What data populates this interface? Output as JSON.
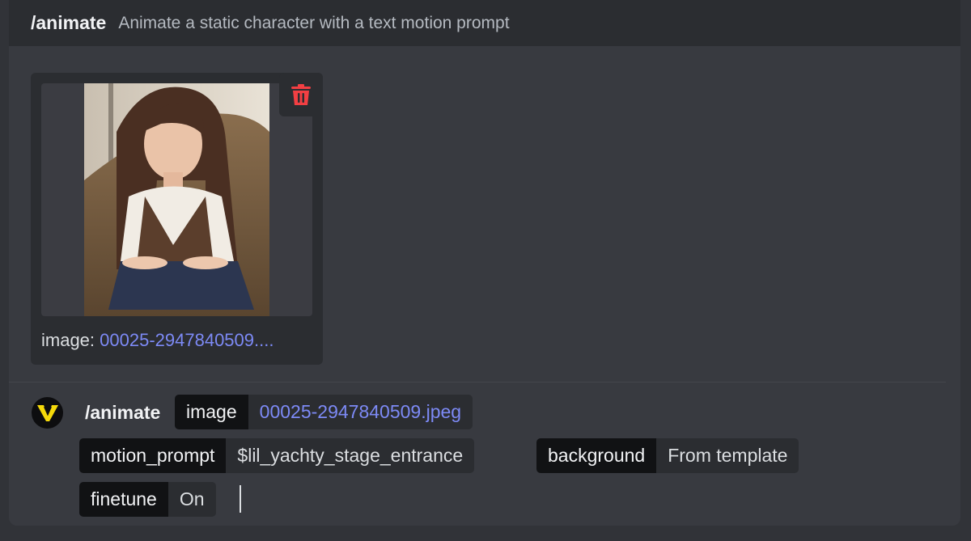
{
  "header": {
    "command": "/animate",
    "description": "Animate a static character with a text motion prompt"
  },
  "attachment": {
    "label_prefix": "image: ",
    "filename_truncated": "00025-2947840509....",
    "delete_icon": "trash-icon",
    "image_description_icon": "photo-thumbnail"
  },
  "composer": {
    "avatar_icon": "v-logo-icon",
    "command": "/animate",
    "options": [
      {
        "key": "image",
        "value": "00025-2947840509.jpeg"
      },
      {
        "key": "motion_prompt",
        "value": "$lil_yachty_stage_entrance"
      },
      {
        "key": "background",
        "value": "From template"
      },
      {
        "key": "finetune",
        "value": "On"
      }
    ]
  },
  "colors": {
    "link": "#7d8af6",
    "delete": "#f23f43",
    "logo": "#f5d90a"
  }
}
